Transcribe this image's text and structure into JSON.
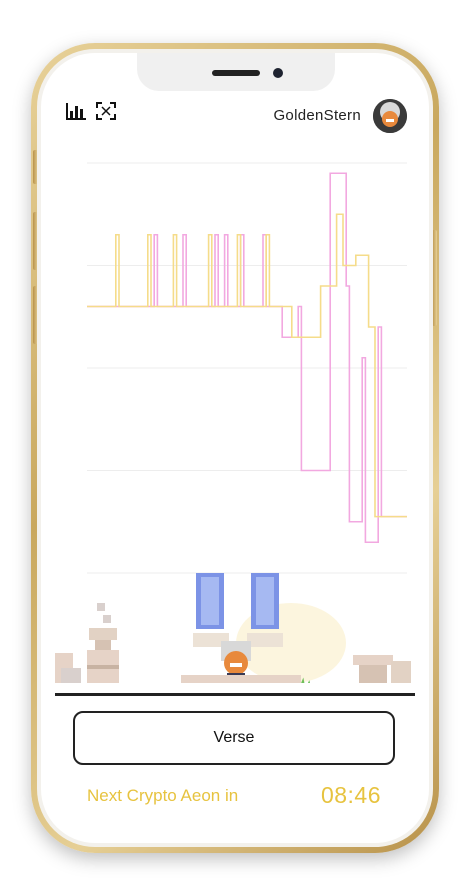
{
  "header": {
    "username": "GoldenStern",
    "stats_icon": "bar-chart-icon",
    "fullscreen_icon": "fullscreen-icon"
  },
  "main": {
    "action_button_label": "Verse"
  },
  "footer": {
    "aeon_label": "Next Crypto Aeon in",
    "aeon_timer": "08:46"
  },
  "colors": {
    "accent_gold": "#e7c33f",
    "series_pink": "#f2a8e0",
    "series_yellow": "#f5dc8a",
    "phone_gold": "#c9a85e"
  },
  "chart_data": {
    "type": "line",
    "title": "",
    "xlabel": "",
    "ylabel": "",
    "y_tick_labels": [
      "",
      "",
      "",
      "",
      ""
    ],
    "grid": true,
    "legend": "none",
    "series": [
      {
        "color": "#f2a8e0",
        "x": [
          0,
          20,
          21,
          22,
          23,
          29,
          30,
          31,
          32,
          39,
          40,
          41,
          42,
          43,
          44,
          47,
          48,
          49,
          50,
          54,
          55,
          56,
          60,
          61,
          65,
          66,
          67,
          75,
          76,
          80,
          81,
          82,
          85,
          86,
          87,
          90,
          91,
          92,
          100
        ],
        "y": [
          2.6,
          2.6,
          3.3,
          2.6,
          2.6,
          2.6,
          3.3,
          2.6,
          2.6,
          2.6,
          3.3,
          2.6,
          2.6,
          3.3,
          2.6,
          2.6,
          3.3,
          2.6,
          2.6,
          2.6,
          3.3,
          2.6,
          2.6,
          2.3,
          2.3,
          2.6,
          1.0,
          1.0,
          3.9,
          3.9,
          2.8,
          0.5,
          0.5,
          2.1,
          0.3,
          0.3,
          2.4,
          0.55,
          0.55
        ]
      },
      {
        "color": "#f5dc8a",
        "x": [
          0,
          8,
          9,
          10,
          18,
          19,
          20,
          26,
          27,
          28,
          37,
          38,
          39,
          46,
          47,
          48,
          55,
          56,
          57,
          63,
          64,
          65,
          72,
          73,
          74,
          78,
          79,
          80,
          83,
          84,
          85,
          88,
          89,
          90,
          100
        ],
        "y": [
          2.6,
          2.6,
          3.3,
          2.6,
          2.6,
          3.3,
          2.6,
          2.6,
          3.3,
          2.6,
          2.6,
          3.3,
          2.6,
          2.6,
          3.3,
          2.6,
          2.6,
          3.3,
          2.6,
          2.6,
          2.3,
          2.3,
          2.3,
          2.8,
          2.8,
          3.5,
          3.5,
          3.0,
          3.0,
          3.1,
          3.1,
          2.4,
          2.4,
          0.55,
          0.55
        ]
      }
    ],
    "ylim": [
      0,
      4
    ],
    "xlim": [
      0,
      100
    ]
  }
}
